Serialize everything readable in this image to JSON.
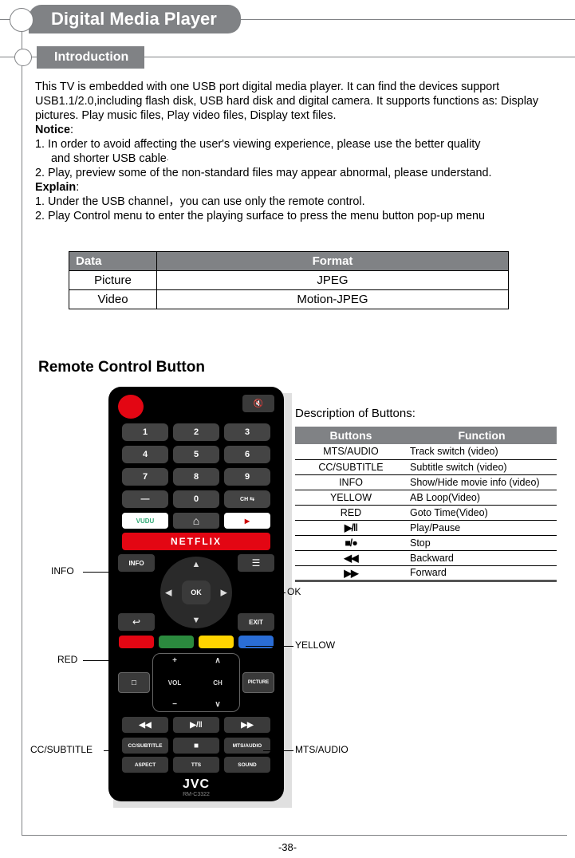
{
  "title": "Digital Media Player",
  "section": "Introduction",
  "intro_text": "This TV is embedded with one USB port digital media player. It can find the devices support USB1.1/2.0,including flash disk, USB hard disk and digital camera. It supports functions as: Display pictures. Play music files, Play video files, Display text files.",
  "notice_heading": "Notice",
  "notice_1": "1. In order to avoid affecting the user's viewing experience, please use the better quality",
  "notice_1b": "and shorter USB cable",
  "notice_2": "2. Play, preview some of the non-standard files may appear abnormal, please understand.",
  "explain_heading": "Explain",
  "explain_1": "1. Under the USB channel，you can use only the remote control.",
  "explain_2": "2. Play Control menu to enter the playing surface to press the menu button pop-up menu",
  "df_headers": {
    "data": "Data",
    "format": "Format"
  },
  "df_rows": [
    {
      "data": "Picture",
      "format": "JPEG"
    },
    {
      "data": "Video",
      "format": "Motion-JPEG"
    }
  ],
  "remote_heading": "Remote Control Button",
  "remote": {
    "numbers": [
      "1",
      "2",
      "3",
      "4",
      "5",
      "6",
      "7",
      "8",
      "9",
      "0"
    ],
    "dash": "—",
    "ch_return": "CH ⇆",
    "vudu": "VUDU",
    "home": "⌂",
    "youtube": "▶",
    "netflix": "NETFLIX",
    "info": "INFO",
    "menu": "☰",
    "ok": "OK",
    "return": "↩",
    "exit": "EXIT",
    "vol": "VOL",
    "ch": "CH",
    "cc_tiny": "☐",
    "picture": "PICTURE",
    "media": {
      "rew": "◀◀",
      "play": "▶/‖",
      "fwd": "▶▶"
    },
    "row6": {
      "cc": "CC/SUBTITLE",
      "stop": "■",
      "mts": "MTS/AUDIO"
    },
    "row7": {
      "aspect": "ASPECT",
      "tts": "TTS",
      "sound": "SOUND"
    },
    "brand": "JVC",
    "model": "RM-C3322"
  },
  "callouts": {
    "info": "INFO",
    "ok": "OK",
    "yellow": "YELLOW",
    "red": "RED",
    "cc": "CC/SUBTITLE",
    "mts": "MTS/AUDIO"
  },
  "desc_heading": "Description of Buttons:",
  "bt_headers": {
    "buttons": "Buttons",
    "function": "Function"
  },
  "bt_rows": [
    {
      "b": "MTS/AUDIO",
      "f": "Track switch (video)"
    },
    {
      "b": "CC/SUBTITLE",
      "f": "Subtitle switch (video)"
    },
    {
      "b": "INFO",
      "f": "Show/Hide movie info (video)"
    },
    {
      "b": "YELLOW",
      "f": "AB Loop(Video)"
    },
    {
      "b": "RED",
      "f": "Goto Time(Video)"
    },
    {
      "b": "▶/‖",
      "f": "Play/Pause",
      "sym": true
    },
    {
      "b": "■/●",
      "f": "Stop",
      "sym": true
    },
    {
      "b": "◀◀",
      "f": "Backward",
      "sym": true
    },
    {
      "b": "▶▶",
      "f": "Forward",
      "sym": true
    }
  ],
  "page_no": "-38-"
}
